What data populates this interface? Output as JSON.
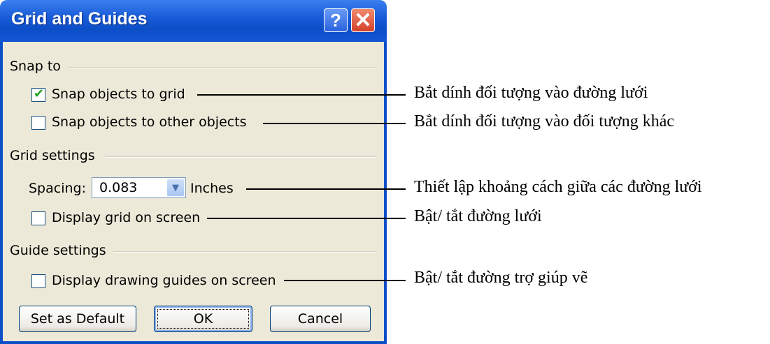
{
  "dialog": {
    "title": "Grid and Guides",
    "help_label": "?",
    "close_label": "✕",
    "snap_group": {
      "label": "Snap to",
      "objects_to_grid": {
        "label": "Snap objects to grid",
        "checked": true
      },
      "objects_to_objects": {
        "label": "Snap objects to other objects",
        "checked": false
      }
    },
    "grid_group": {
      "label": "Grid settings",
      "spacing_label": "Spacing:",
      "spacing_value": "0.083",
      "spacing_unit": "Inches",
      "display_grid": {
        "label": "Display grid on screen",
        "checked": false
      }
    },
    "guide_group": {
      "label": "Guide settings",
      "display_guides": {
        "label": "Display drawing guides on screen",
        "checked": false
      }
    },
    "buttons": {
      "default_label": "Set as Default",
      "ok_label": "OK",
      "cancel_label": "Cancel"
    }
  },
  "annotations": [
    "Bắt dính đối tượng vào đường lưới",
    "Bắt dính đối tượng vào đối tượng khác",
    "Thiết lập khoảng cách giữa các đường lưới",
    "Bật/ tắt đường lưới",
    "Bật/ tắt đường trợ giúp vẽ"
  ],
  "colors": {
    "titlebar": "#0b4ec7",
    "dialog_bg": "#ece9d8",
    "check": "#21a121"
  }
}
